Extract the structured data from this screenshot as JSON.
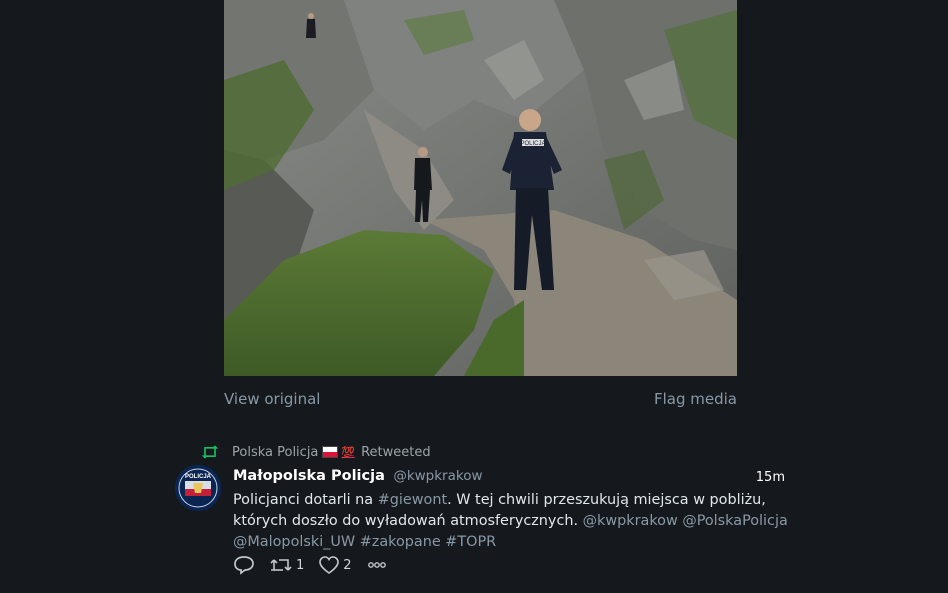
{
  "media": {
    "view_original": "View original",
    "flag_media": "Flag media",
    "badge_text": "POLICJA"
  },
  "retweet": {
    "by": "Polska Policja",
    "emoji": "💯",
    "label": "Retweeted"
  },
  "tweet": {
    "display_name": "Małopolska Policja",
    "handle": "@kwpkrakow",
    "time": "15m",
    "text_parts": {
      "p1": "Policjanci dotarli na ",
      "hashtag1": "#giewont",
      "p2": ". W tej chwili przeszukują miejsca w pobliżu, których doszło do wyładowań atmosferycznych. ",
      "mention1": "@kwpkrakow",
      "mention2": "@PolskaPolicja",
      "mention3": "@Malopolski_UW",
      "hashtag2": "#zakopane",
      "hashtag3": "#TOPR"
    },
    "retweet_count": "1",
    "like_count": "2"
  },
  "avatar": {
    "badge_text": "POLICJA"
  },
  "icons": {
    "retweeted": "retweet-icon",
    "reply": "reply-icon",
    "retweet": "retweet-icon",
    "like": "heart-icon",
    "more": "more-icon"
  },
  "colors": {
    "background": "#15181c",
    "link": "#8899a6",
    "retweet_green": "#17bf63"
  }
}
